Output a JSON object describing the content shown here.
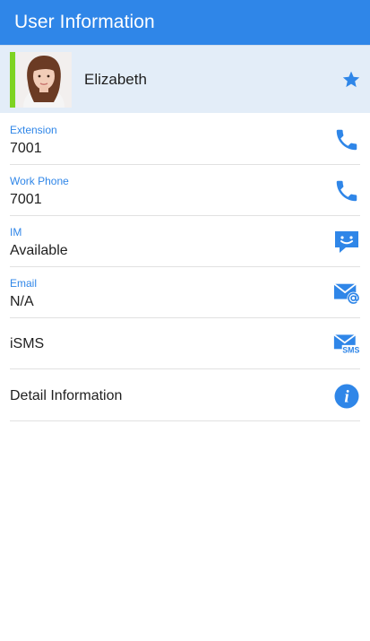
{
  "app_bar": {
    "title": "User Information"
  },
  "user": {
    "name": "Elizabeth",
    "presence_color": "#7ed321",
    "favorite_icon": "star-icon"
  },
  "colors": {
    "accent": "#2f86e8",
    "header_bg": "#e3edf8"
  },
  "rows": [
    {
      "label": "Extension",
      "value": "7001",
      "icon": "phone-icon"
    },
    {
      "label": "Work Phone",
      "value": "7001",
      "icon": "phone-icon"
    },
    {
      "label": "IM",
      "value": "Available",
      "icon": "chat-smile-icon"
    },
    {
      "label": "Email",
      "value": "N/A",
      "icon": "email-at-icon"
    },
    {
      "title": "iSMS",
      "icon": "sms-envelope-icon",
      "icon_text": "SMS"
    },
    {
      "title": "Detail Information",
      "icon": "info-icon",
      "icon_text": "i"
    }
  ]
}
